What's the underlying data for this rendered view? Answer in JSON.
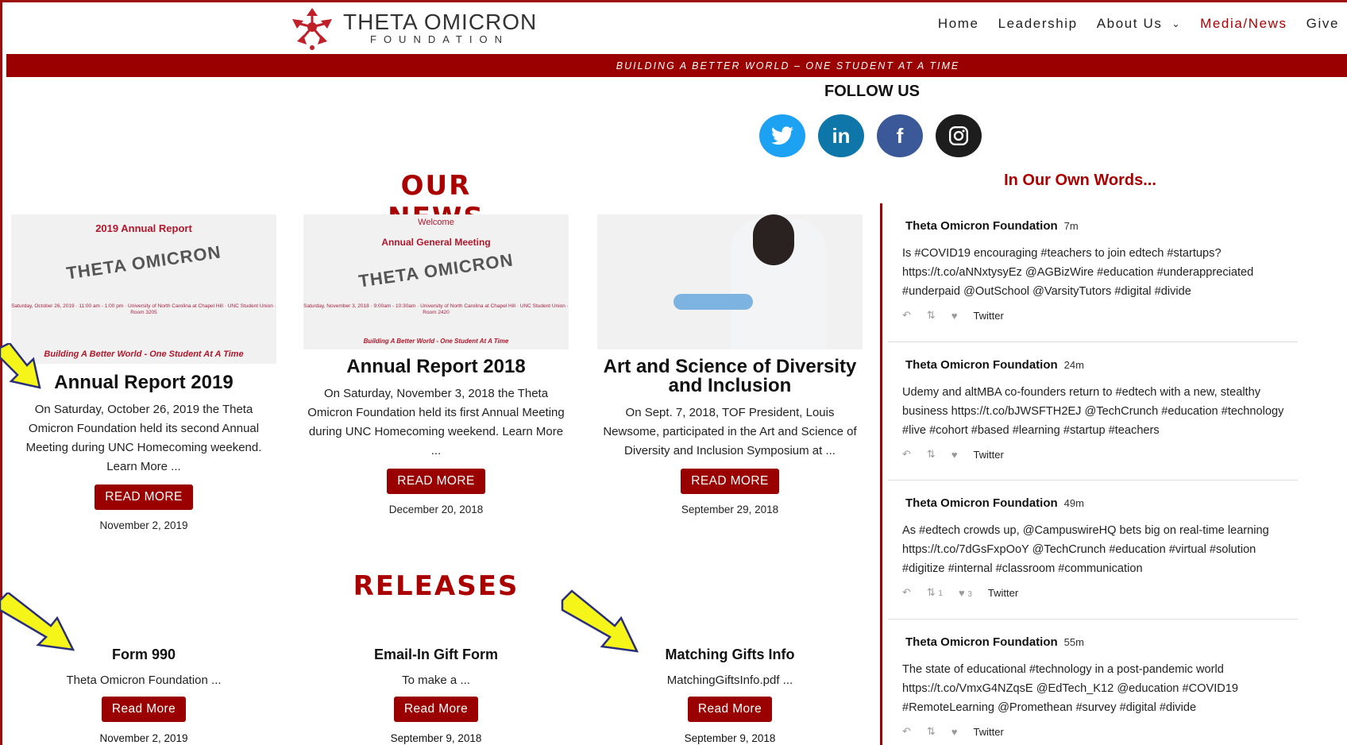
{
  "brand": {
    "name": "THETA OMICRON",
    "sub": "FOUNDATION"
  },
  "nav": {
    "items": [
      "Home",
      "Leadership",
      "About Us",
      "Media/News",
      "Give"
    ],
    "active": "Media/News"
  },
  "tagline": "BUILDING A BETTER WORLD – ONE STUDENT AT A TIME",
  "follow": {
    "title": "FOLLOW US",
    "icons": [
      "twitter-icon",
      "linkedin-icon",
      "facebook-icon",
      "instagram-icon"
    ]
  },
  "news": {
    "heading": "OUR NEWS",
    "cards": [
      {
        "thumb_title": "2019 Annual Report",
        "thumb_name": "THETA OMICRON",
        "thumb_meta": "Saturday, October 26, 2019 · 11:00 am - 1:00 pm · University of North Carolina at Chapel Hill · UNC Student Union · Room 3205",
        "thumb_tagline": "Building A Better World - One Student At A Time",
        "title": "Annual Report 2019",
        "desc": "On Saturday, October 26, 2019 the Theta Omicron Foundation held its second Annual Meeting during UNC Homecoming weekend. Learn More ...",
        "button": "READ MORE",
        "date": "November 2, 2019"
      },
      {
        "thumb_title": "Annual General Meeting",
        "thumb_welcome": "Welcome",
        "thumb_name": "THETA OMICRON",
        "thumb_meta": "Saturday, November 3, 2018 · 9:00am - 10:30am · University of North Carolina at Chapel Hill · UNC Student Union · Room 2420",
        "thumb_tagline": "Building A Better World - One Student At A Time",
        "title": "Annual Report 2018",
        "desc": "On Saturday, November 3, 2018 the Theta Omicron Foundation held its first Annual Meeting during UNC Homecoming weekend. Learn More ...",
        "button": "READ MORE",
        "date": "December 20, 2018"
      },
      {
        "title": "Art and Science of Diversity and Inclusion",
        "desc": "On Sept. 7, 2018, TOF President, Louis Newsome, participated in the Art and Science of Diversity and Inclusion Symposium at ...",
        "button": "READ MORE",
        "date": "September 29, 2018"
      }
    ]
  },
  "releases": {
    "heading": "RELEASES",
    "items": [
      {
        "title": "Form 990",
        "desc": "Theta Omicron Foundation ...",
        "button": "Read More",
        "date": "November 2, 2019"
      },
      {
        "title": "Email-In Gift Form",
        "desc": "To make a ...",
        "button": "Read More",
        "date": "September 9, 2018"
      },
      {
        "title": "Matching Gifts Info",
        "desc": "MatchingGiftsInfo.pdf ...",
        "button": "Read More",
        "date": "September 9, 2018"
      }
    ]
  },
  "words": {
    "title": "In Our Own Words...",
    "tweets": [
      {
        "author": "Theta Omicron Foundation",
        "time": "7m",
        "text": "Is #COVID19 encouraging #teachers to join edtech #startups? https://t.co/aNNxtysyEz @AGBizWire #education #underappreciated #underpaid @OutSchool @VarsityTutors #digital #divide",
        "retweets": "",
        "likes": "",
        "source": "Twitter"
      },
      {
        "author": "Theta Omicron Foundation",
        "time": "24m",
        "text": "Udemy and altMBA co-founders return to #edtech with a new, stealthy business https://t.co/bJWSFTH2EJ @TechCrunch #education #technology #live #cohort #based #learning #startup #teachers",
        "retweets": "",
        "likes": "",
        "source": "Twitter"
      },
      {
        "author": "Theta Omicron Foundation",
        "time": "49m",
        "text": "As #edtech crowds up, @CampuswireHQ bets big on real-time learning https://t.co/7dGsFxpOoY @TechCrunch #education #virtual #solution #digitize #internal #classroom #communication",
        "retweets": "1",
        "likes": "3",
        "source": "Twitter"
      },
      {
        "author": "Theta Omicron Foundation",
        "time": "55m",
        "text": "The state of educational #technology in a post-pandemic world https://t.co/VmxG4NZqsE @EdTech_K12 @education #COVID19 #RemoteLearning @Promethean #survey #digital #divide",
        "retweets": "",
        "likes": "",
        "source": "Twitter"
      }
    ]
  },
  "colors": {
    "brand_red": "#9b0000",
    "twitter": "#1da1f2",
    "linkedin": "#0e76a8",
    "facebook": "#3b5998",
    "instagram": "#1d1d1d",
    "annotation_arrow": "#f5f51a"
  }
}
